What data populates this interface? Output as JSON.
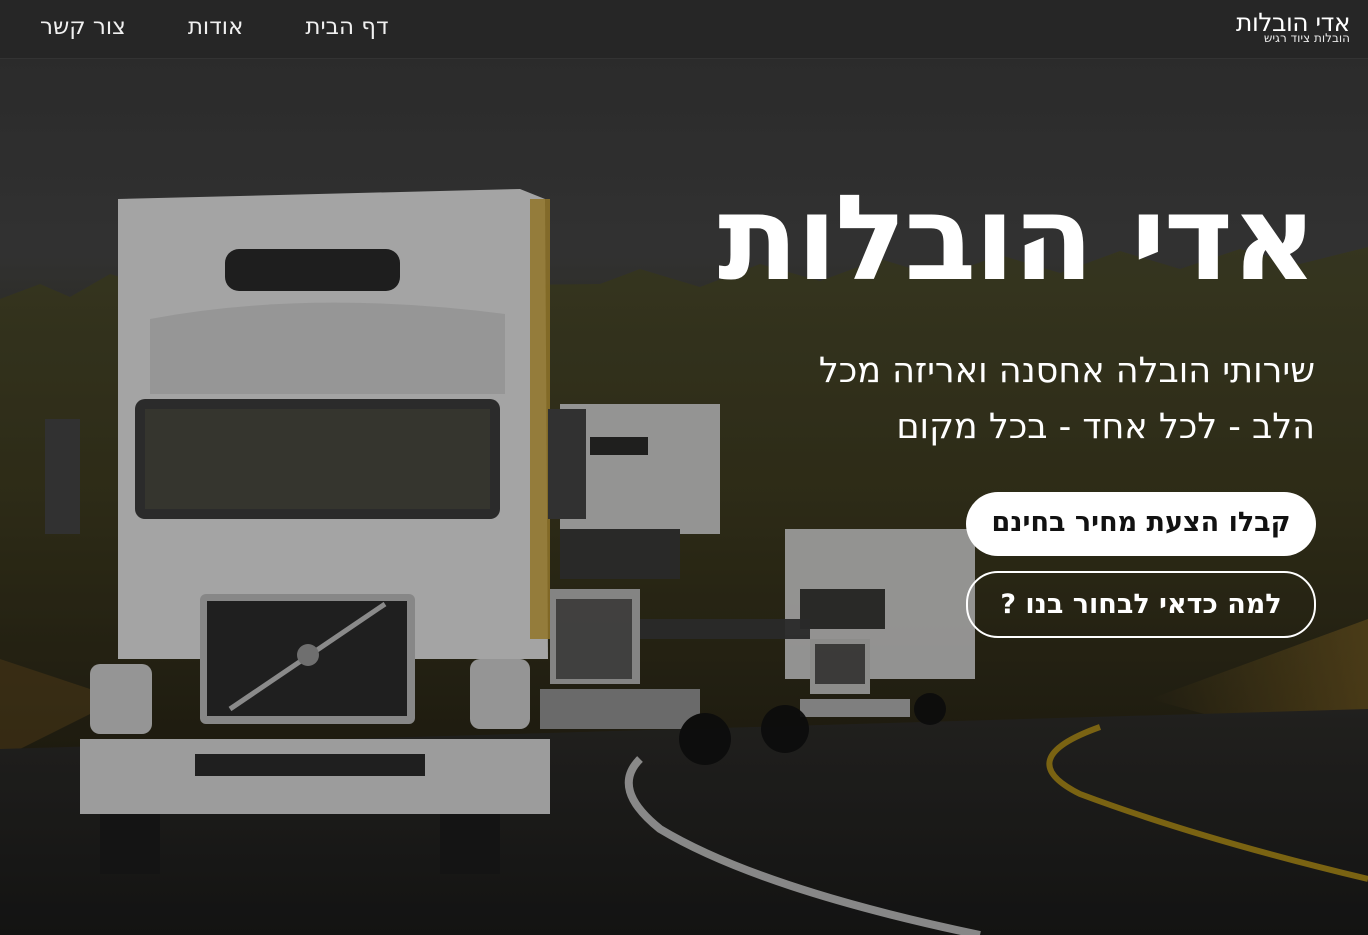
{
  "nav": {
    "brand_name": "אדי הובלות",
    "brand_tagline": "הובלות ציוד רגיש",
    "links": [
      "דף הבית",
      "אודות",
      "צור קשר"
    ]
  },
  "hero": {
    "title": "אדי הובלות",
    "subtitle_line1": "שירותי הובלה אחסנה ואריזה מכל",
    "subtitle_line2": "הלב - לכל אחד - בכל מקום",
    "primary_cta": "קבלו הצעת מחיר בחינם",
    "secondary_cta": "למה כדאי לבחור בנו ?"
  },
  "colors": {
    "nav_background": "#262626",
    "primary_button": "#ffffff",
    "text": "#ffffff"
  }
}
